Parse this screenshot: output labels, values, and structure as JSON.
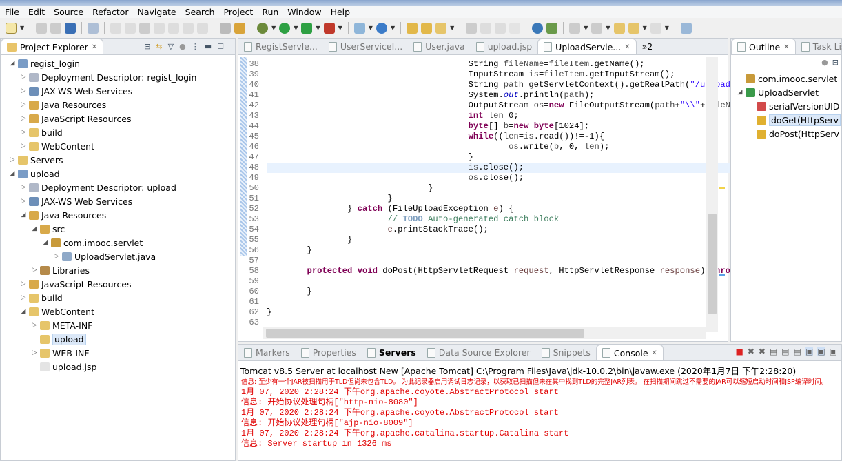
{
  "menu": [
    "File",
    "Edit",
    "Source",
    "Refactor",
    "Navigate",
    "Search",
    "Project",
    "Run",
    "Window",
    "Help"
  ],
  "explorer": {
    "tab_label": "Project Explorer",
    "items": [
      {
        "label": "regist_login",
        "level": 0,
        "arrow": "expanded",
        "icon": "project-icon"
      },
      {
        "label": "Deployment Descriptor: regist_login",
        "level": 1,
        "arrow": "collapsed",
        "icon": "deployment-descriptor-icon"
      },
      {
        "label": "JAX-WS Web Services",
        "level": 1,
        "arrow": "collapsed",
        "icon": "web-services-icon"
      },
      {
        "label": "Java Resources",
        "level": 1,
        "arrow": "collapsed",
        "icon": "java-resources-icon"
      },
      {
        "label": "JavaScript Resources",
        "level": 1,
        "arrow": "collapsed",
        "icon": "javascript-resources-icon"
      },
      {
        "label": "build",
        "level": 1,
        "arrow": "collapsed",
        "icon": "folder-icon"
      },
      {
        "label": "WebContent",
        "level": 1,
        "arrow": "collapsed",
        "icon": "folder-icon"
      },
      {
        "label": "Servers",
        "level": 0,
        "arrow": "collapsed",
        "icon": "folder-icon"
      },
      {
        "label": "upload",
        "level": 0,
        "arrow": "expanded",
        "icon": "project-icon"
      },
      {
        "label": "Deployment Descriptor: upload",
        "level": 1,
        "arrow": "collapsed",
        "icon": "deployment-descriptor-icon"
      },
      {
        "label": "JAX-WS Web Services",
        "level": 1,
        "arrow": "collapsed",
        "icon": "web-services-icon"
      },
      {
        "label": "Java Resources",
        "level": 1,
        "arrow": "expanded",
        "icon": "java-resources-icon"
      },
      {
        "label": "src",
        "level": 2,
        "arrow": "expanded",
        "icon": "source-folder-icon"
      },
      {
        "label": "com.imooc.servlet",
        "level": 3,
        "arrow": "expanded",
        "icon": "package-icon"
      },
      {
        "label": "UploadServlet.java",
        "level": 4,
        "arrow": "collapsed",
        "icon": "java-file-icon"
      },
      {
        "label": "Libraries",
        "level": 2,
        "arrow": "collapsed",
        "icon": "libraries-icon"
      },
      {
        "label": "JavaScript Resources",
        "level": 1,
        "arrow": "collapsed",
        "icon": "javascript-resources-icon"
      },
      {
        "label": "build",
        "level": 1,
        "arrow": "collapsed",
        "icon": "folder-icon"
      },
      {
        "label": "WebContent",
        "level": 1,
        "arrow": "expanded",
        "icon": "folder-icon"
      },
      {
        "label": "META-INF",
        "level": 2,
        "arrow": "collapsed",
        "icon": "folder-icon"
      },
      {
        "label": "upload",
        "level": 2,
        "arrow": "none",
        "icon": "folder-icon",
        "selected": true
      },
      {
        "label": "WEB-INF",
        "level": 2,
        "arrow": "collapsed",
        "icon": "folder-icon"
      },
      {
        "label": "upload.jsp",
        "level": 2,
        "arrow": "none",
        "icon": "jsp-file-icon"
      }
    ]
  },
  "editor": {
    "tabs": [
      {
        "label": "RegistServle...",
        "active": false
      },
      {
        "label": "UserServiceI...",
        "active": false
      },
      {
        "label": "User.java",
        "active": false
      },
      {
        "label": "upload.jsp",
        "active": false
      },
      {
        "label": "UploadServle...",
        "active": true
      }
    ],
    "overflow_label": "»2",
    "highlight_line": 48,
    "lines": [
      {
        "n": "38",
        "i": 5,
        "s": [
          [
            "t",
            "String "
          ],
          [
            "vr",
            "fileName"
          ],
          [
            "t",
            "="
          ],
          [
            "vr",
            "fileItem"
          ],
          [
            "t",
            ".getName();"
          ]
        ]
      },
      {
        "n": "39",
        "i": 5,
        "s": [
          [
            "t",
            "InputStream "
          ],
          [
            "vr",
            "is"
          ],
          [
            "t",
            "="
          ],
          [
            "vr",
            "fileItem"
          ],
          [
            "t",
            ".getInputStream();"
          ]
        ]
      },
      {
        "n": "40",
        "i": 5,
        "s": [
          [
            "t",
            "String "
          ],
          [
            "vr",
            "path"
          ],
          [
            "t",
            "=getServletContext().getRealPath("
          ],
          [
            "str",
            "\"/upload\""
          ],
          [
            "t",
            ");"
          ]
        ]
      },
      {
        "n": "41",
        "i": 5,
        "s": [
          [
            "t",
            "System."
          ],
          [
            "fld",
            "out"
          ],
          [
            "t",
            ".println("
          ],
          [
            "vr",
            "path"
          ],
          [
            "t",
            ");"
          ]
        ]
      },
      {
        "n": "42",
        "i": 5,
        "s": [
          [
            "t",
            "OutputStream "
          ],
          [
            "vr",
            "os"
          ],
          [
            "t",
            "="
          ],
          [
            "kw",
            "new"
          ],
          [
            "t",
            " FileOutputStream("
          ],
          [
            "vr",
            "path"
          ],
          [
            "t",
            "+"
          ],
          [
            "str",
            "\"\\\\\""
          ],
          [
            "t",
            "+"
          ],
          [
            "vr",
            "fileName"
          ],
          [
            "t",
            ");"
          ]
        ]
      },
      {
        "n": "43",
        "i": 5,
        "s": [
          [
            "kw",
            "int"
          ],
          [
            "t",
            " "
          ],
          [
            "vr",
            "len"
          ],
          [
            "t",
            "=0;"
          ]
        ]
      },
      {
        "n": "44",
        "i": 5,
        "s": [
          [
            "kw",
            "byte"
          ],
          [
            "t",
            "[] "
          ],
          [
            "vr",
            "b"
          ],
          [
            "t",
            "="
          ],
          [
            "kw",
            "new"
          ],
          [
            "t",
            " "
          ],
          [
            "kw",
            "byte"
          ],
          [
            "t",
            "[1024];"
          ]
        ]
      },
      {
        "n": "45",
        "i": 5,
        "s": [
          [
            "kw",
            "while"
          ],
          [
            "t",
            "(("
          ],
          [
            "vr",
            "len"
          ],
          [
            "t",
            "="
          ],
          [
            "vr",
            "is"
          ],
          [
            "t",
            ".read())!=-1){"
          ]
        ]
      },
      {
        "n": "46",
        "i": 6,
        "s": [
          [
            "vr",
            "os"
          ],
          [
            "t",
            ".write("
          ],
          [
            "vr",
            "b"
          ],
          [
            "t",
            ", 0, "
          ],
          [
            "vr",
            "len"
          ],
          [
            "t",
            ");"
          ]
        ]
      },
      {
        "n": "47",
        "i": 5,
        "s": [
          [
            "t",
            "}"
          ]
        ]
      },
      {
        "n": "48",
        "i": 5,
        "s": [
          [
            "vr",
            "is"
          ],
          [
            "t",
            ".close();"
          ]
        ]
      },
      {
        "n": "49",
        "i": 5,
        "s": [
          [
            "vr",
            "os"
          ],
          [
            "t",
            ".close();"
          ]
        ]
      },
      {
        "n": "50",
        "i": 4,
        "s": [
          [
            "t",
            "}"
          ]
        ]
      },
      {
        "n": "51",
        "i": 3,
        "s": [
          [
            "t",
            "}"
          ]
        ]
      },
      {
        "n": "52",
        "i": 2,
        "s": [
          [
            "t",
            "} "
          ],
          [
            "kw",
            "catch"
          ],
          [
            "t",
            " (FileUploadException "
          ],
          [
            "par",
            "e"
          ],
          [
            "t",
            ") {"
          ]
        ]
      },
      {
        "n": "53",
        "i": 3,
        "s": [
          [
            "cm",
            "// "
          ],
          [
            "todo",
            "TODO"
          ],
          [
            "cm",
            " Auto-generated catch block"
          ]
        ]
      },
      {
        "n": "54",
        "i": 3,
        "s": [
          [
            "par",
            "e"
          ],
          [
            "t",
            ".printStackTrace();"
          ]
        ]
      },
      {
        "n": "55",
        "i": 2,
        "s": [
          [
            "t",
            "}"
          ]
        ]
      },
      {
        "n": "56",
        "i": 1,
        "s": [
          [
            "t",
            "}"
          ]
        ]
      },
      {
        "n": "57",
        "i": 0,
        "s": []
      },
      {
        "n": "58",
        "i": 1,
        "s": [
          [
            "kw",
            "protected"
          ],
          [
            "t",
            " "
          ],
          [
            "kw",
            "void"
          ],
          [
            "t",
            " doPost(HttpServletRequest "
          ],
          [
            "par",
            "request"
          ],
          [
            "t",
            ", HttpServletResponse "
          ],
          [
            "par",
            "response"
          ],
          [
            "t",
            ") "
          ],
          [
            "kw",
            "throws"
          ]
        ]
      },
      {
        "n": "59",
        "i": 0,
        "s": []
      },
      {
        "n": "60",
        "i": 1,
        "s": [
          [
            "t",
            "}"
          ]
        ]
      },
      {
        "n": "61",
        "i": 0,
        "s": []
      },
      {
        "n": "62",
        "i": 0,
        "s": [
          [
            "t",
            "}"
          ]
        ]
      },
      {
        "n": "63",
        "i": 0,
        "s": []
      }
    ]
  },
  "outline": {
    "tabs": [
      {
        "label": "Outline",
        "active": true
      },
      {
        "label": "Task List",
        "active": false
      }
    ],
    "items": [
      {
        "label": "com.imooc.servlet",
        "level": 0,
        "arrow": "none",
        "icon": "package-icon"
      },
      {
        "label": "UploadServlet",
        "level": 0,
        "arrow": "expanded",
        "icon": "class-icon"
      },
      {
        "label": "serialVersionUID",
        "level": 1,
        "arrow": "none",
        "icon": "static-final-field-icon"
      },
      {
        "label": "doGet(HttpServ",
        "level": 1,
        "arrow": "none",
        "icon": "protected-method-icon",
        "selected": true
      },
      {
        "label": "doPost(HttpServ",
        "level": 1,
        "arrow": "none",
        "icon": "protected-method-icon"
      }
    ]
  },
  "bottom": {
    "tabs": [
      {
        "label": "Markers",
        "active": false
      },
      {
        "label": "Properties",
        "active": false
      },
      {
        "label": "Servers",
        "active": false,
        "bold": true
      },
      {
        "label": "Data Source Explorer",
        "active": false
      },
      {
        "label": "Snippets",
        "active": false
      },
      {
        "label": "Console",
        "active": true
      }
    ],
    "console_header": "Tomcat v8.5 Server at localhost New [Apache Tomcat] C:\\Program Files\\Java\\jdk-10.0.2\\bin\\javaw.exe (2020年1月7日 下午2:28:20)",
    "console_lines": [
      {
        "text": "信息: 至少有一个JAR被扫描用于TLD但尚未包含TLD。 为此记录器启用调试日志记录，以获取已扫描但未在其中找到TLD的完整JAR列表。 在扫描期间跳过不需要的JAR可以缩短启动时间和JSP编译时间。",
        "small": true
      },
      {
        "text": "1月 07, 2020 2:28:24 下午org.apache.coyote.AbstractProtocol start"
      },
      {
        "text": "信息: 开始协议处理句柄[\"http-nio-8080\"]"
      },
      {
        "text": "1月 07, 2020 2:28:24 下午org.apache.coyote.AbstractProtocol start"
      },
      {
        "text": "信息: 开始协议处理句柄[\"ajp-nio-8009\"]"
      },
      {
        "text": "1月 07, 2020 2:28:24 下午org.apache.catalina.startup.Catalina start"
      },
      {
        "text": "信息: Server startup in 1326 ms"
      }
    ]
  },
  "colors": {
    "keyword": "#7f0055",
    "string": "#2a00ff",
    "field": "#0000c0",
    "comment": "#3f7f5f",
    "console_error": "#e00000",
    "current_line": "#e8f2fe"
  }
}
